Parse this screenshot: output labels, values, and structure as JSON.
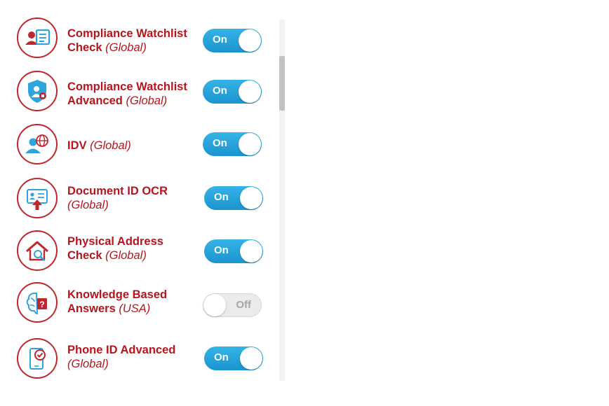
{
  "services": [
    {
      "name": "Compliance Watchlist",
      "name2": "Check",
      "scope": "(Global)",
      "icon": "watchlist-check-icon",
      "toggle": "On",
      "enabled": true
    },
    {
      "name": "Compliance Watchlist",
      "name2": "Advanced",
      "scope": "(Global)",
      "icon": "watchlist-advanced-shield-icon",
      "toggle": "On",
      "enabled": true
    },
    {
      "name": "IDV",
      "name2": "",
      "scope": "(Global)",
      "icon": "idv-globe-user-icon",
      "toggle": "On",
      "enabled": true
    },
    {
      "name": "Document ID OCR",
      "name2": "",
      "scope": "(Global)",
      "icon": "document-id-upload-icon",
      "toggle": "On",
      "enabled": true
    },
    {
      "name": "Physical Address",
      "name2": "Check",
      "scope": "(Global)",
      "icon": "house-search-icon",
      "toggle": "On",
      "enabled": true
    },
    {
      "name": "Knowledge Based",
      "name2": "Answers",
      "scope": "(USA)",
      "icon": "brain-question-icon",
      "toggle": "Off",
      "enabled": false
    },
    {
      "name": "Phone ID Advanced",
      "name2": "",
      "scope": "(Global)",
      "icon": "phone-check-icon",
      "toggle": "On",
      "enabled": true
    }
  ],
  "colors": {
    "accent": "#b5161e",
    "toggle_on": "#29a9df",
    "toggle_off": "#ebebeb",
    "icon_blue": "#2fa3dc"
  }
}
